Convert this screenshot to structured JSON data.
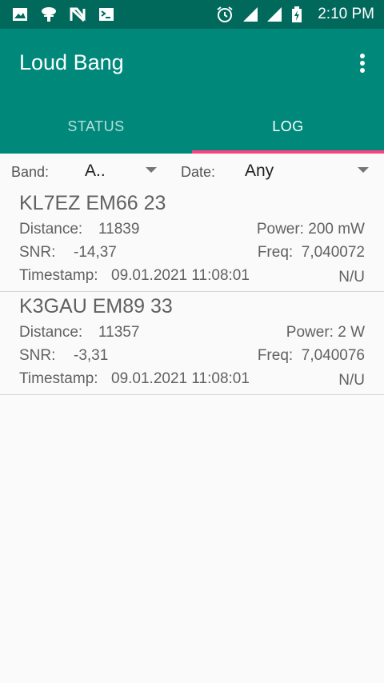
{
  "status_bar": {
    "time": "2:10 PM",
    "left_icons": [
      "image-icon",
      "tree-icon",
      "n-logo-icon",
      "terminal-icon"
    ],
    "right_icons": [
      "alarm-icon",
      "signal-icon",
      "wifi-signal-icon",
      "battery-charging-icon"
    ]
  },
  "app_bar": {
    "title": "Loud Bang",
    "menu_icon": "overflow-menu-icon"
  },
  "tabs": [
    {
      "label": "STATUS",
      "selected": false
    },
    {
      "label": "LOG",
      "selected": true
    }
  ],
  "filters": {
    "band_label": "Band:",
    "band_value": "A..",
    "date_label": "Date:",
    "date_value": "Any"
  },
  "entries": [
    {
      "callsign": "KL7EZ EM66 23",
      "distance_label": "Distance:",
      "distance": "11839",
      "power_label": "Power:",
      "power": "200 mW",
      "snr_label": "SNR:",
      "snr": "-14,37",
      "freq_label": "Freq:",
      "freq": "7,040072",
      "timestamp_label": "Timestamp:",
      "timestamp": "09.01.2021 11:08:01",
      "nu": "N/U"
    },
    {
      "callsign": "K3GAU EM89 33",
      "distance_label": "Distance:",
      "distance": "11357",
      "power_label": "Power:",
      "power": "2 W",
      "snr_label": "SNR:",
      "snr": "-3,31",
      "freq_label": "Freq:",
      "freq": "7,040076",
      "timestamp_label": "Timestamp:",
      "timestamp": "09.01.2021 11:08:01",
      "nu": "N/U"
    }
  ],
  "colors": {
    "status_bar": "#00695c",
    "app_bar": "#00897b",
    "tab_indicator": "#ff4081",
    "background": "#fafafa"
  }
}
